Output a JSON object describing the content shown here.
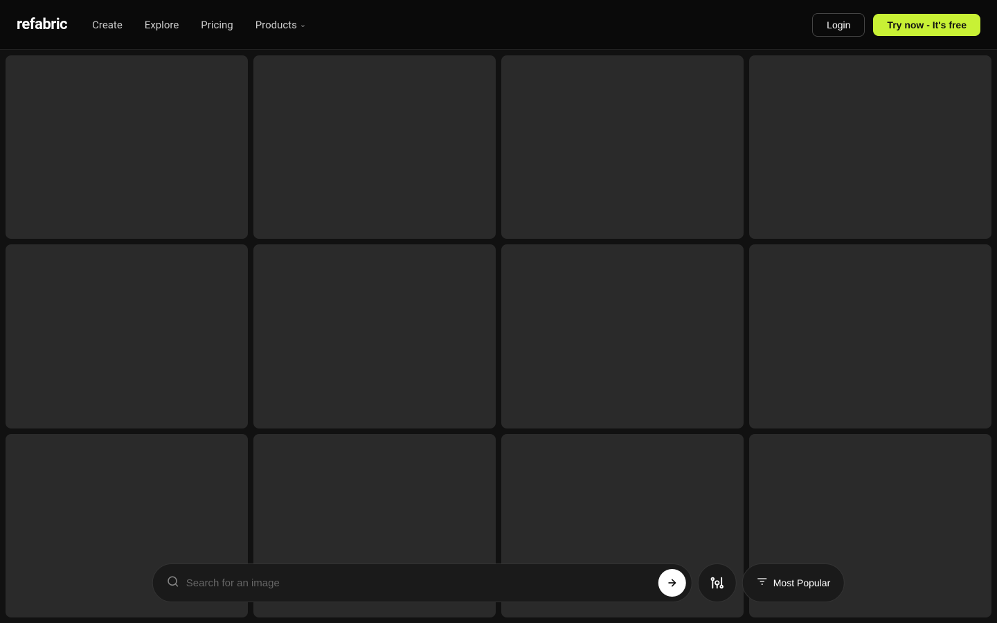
{
  "header": {
    "logo": "refabric",
    "nav": {
      "items": [
        {
          "label": "Create",
          "name": "create"
        },
        {
          "label": "Explore",
          "name": "explore"
        },
        {
          "label": "Pricing",
          "name": "pricing"
        },
        {
          "label": "Products",
          "name": "products",
          "hasChevron": true
        }
      ]
    },
    "login_label": "Login",
    "try_label": "Try now - It's free"
  },
  "grid": {
    "items": [
      {
        "id": 1
      },
      {
        "id": 2
      },
      {
        "id": 3
      },
      {
        "id": 4
      },
      {
        "id": 5
      },
      {
        "id": 6
      },
      {
        "id": 7
      },
      {
        "id": 8
      },
      {
        "id": 9
      },
      {
        "id": 10
      },
      {
        "id": 11
      },
      {
        "id": 12
      }
    ]
  },
  "search": {
    "placeholder": "Search for an image",
    "submit_label": "→",
    "filter_icon": "🎨",
    "sort_label": "Most Popular"
  }
}
